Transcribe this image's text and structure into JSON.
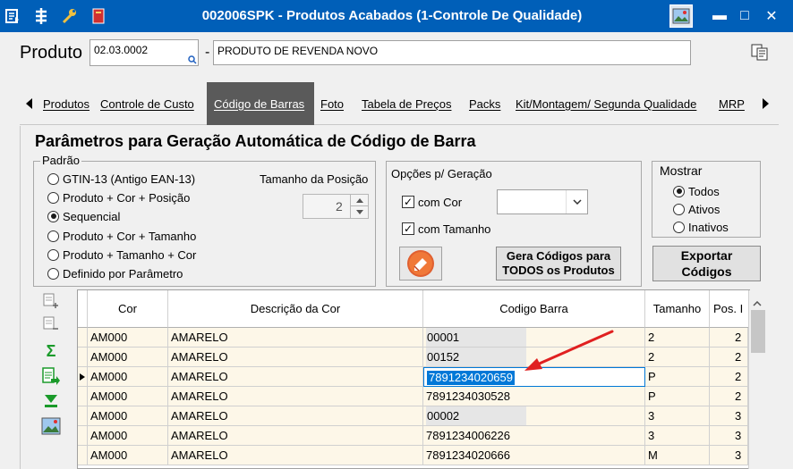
{
  "window": {
    "title": "002006SPK - Produtos Acabados (1-Controle De Qualidade)",
    "controls": {
      "minimize": "▬",
      "maximize": "□",
      "close": "✕"
    }
  },
  "produto": {
    "label": "Produto",
    "code": "02.03.0002",
    "dash": "-",
    "description": "PRODUTO DE REVENDA NOVO"
  },
  "tabs": [
    {
      "label": "Produtos"
    },
    {
      "label": "Controle de Custo"
    },
    {
      "label": "Código de Barras"
    },
    {
      "label": "Foto"
    },
    {
      "label": "Tabela de Preços"
    },
    {
      "label": "Packs"
    },
    {
      "label": "Kit/Montagem/ Segunda Qualidade"
    },
    {
      "label": "MRP"
    }
  ],
  "section_title": "Parâmetros para Geração Automática de Código de Barra",
  "padrao": {
    "legend": "Padrão",
    "options": [
      {
        "label": "GTIN-13 (Antigo EAN-13)",
        "selected": false
      },
      {
        "label": "Produto + Cor + Posição",
        "selected": false
      },
      {
        "label": "Sequencial",
        "selected": true
      },
      {
        "label": "Produto + Cor + Tamanho",
        "selected": false
      },
      {
        "label": "Produto + Tamanho + Cor",
        "selected": false
      },
      {
        "label": "Definido por Parâmetro",
        "selected": false
      }
    ],
    "tamanho_label": "Tamanho da Posição",
    "tamanho_value": "2"
  },
  "opcoes": {
    "legend": "Opções p/ Geração",
    "com_cor": {
      "label": "com Cor",
      "checked": true
    },
    "com_tamanho": {
      "label": "com Tamanho",
      "checked": true
    },
    "cor_select_value": "",
    "gera_button": "Gera Códigos para TODOS os Produtos"
  },
  "mostrar": {
    "legend": "Mostrar",
    "options": [
      {
        "label": "Todos",
        "selected": true
      },
      {
        "label": "Ativos",
        "selected": false
      },
      {
        "label": "Inativos",
        "selected": false
      }
    ],
    "exportar_button": "Exportar Códigos"
  },
  "grid": {
    "columns": [
      "Cor",
      "Descrição da Cor",
      "Codigo Barra",
      "Tamanho",
      "Pos. I"
    ],
    "rows": [
      {
        "cor": "AM000",
        "desc": "AMARELO",
        "codigo": "00001",
        "tam": "2",
        "pos": "2"
      },
      {
        "cor": "AM000",
        "desc": "AMARELO",
        "codigo": "00152",
        "tam": "2",
        "pos": "2"
      },
      {
        "cor": "AM000",
        "desc": "AMARELO",
        "codigo": "7891234020659",
        "tam": "P",
        "pos": "2"
      },
      {
        "cor": "AM000",
        "desc": "AMARELO",
        "codigo": "7891234030528",
        "tam": "P",
        "pos": "2"
      },
      {
        "cor": "AM000",
        "desc": "AMARELO",
        "codigo": "00002",
        "tam": "3",
        "pos": "3"
      },
      {
        "cor": "AM000",
        "desc": "AMARELO",
        "codigo": "7891234006226",
        "tam": "3",
        "pos": "3"
      },
      {
        "cor": "AM000",
        "desc": "AMARELO",
        "codigo": "7891234020666",
        "tam": "M",
        "pos": "3"
      }
    ],
    "selected_row": 2
  },
  "colors": {
    "titlebar": "#005fb8",
    "active_tab": "#5a5a5a",
    "selection": "#0078d7",
    "annotation_arrow": "#e02020",
    "row_cream": "#fdf7e8"
  },
  "icons": {
    "titlebar": [
      "menu-icon",
      "tree-icon",
      "wrench-icon",
      "book-icon"
    ],
    "side_tools": [
      "add-row-icon",
      "remove-row-icon",
      "sigma-icon",
      "export-icon",
      "download-icon",
      "image-icon"
    ],
    "copy": "copy-icon",
    "eraser": "eraser-icon"
  }
}
